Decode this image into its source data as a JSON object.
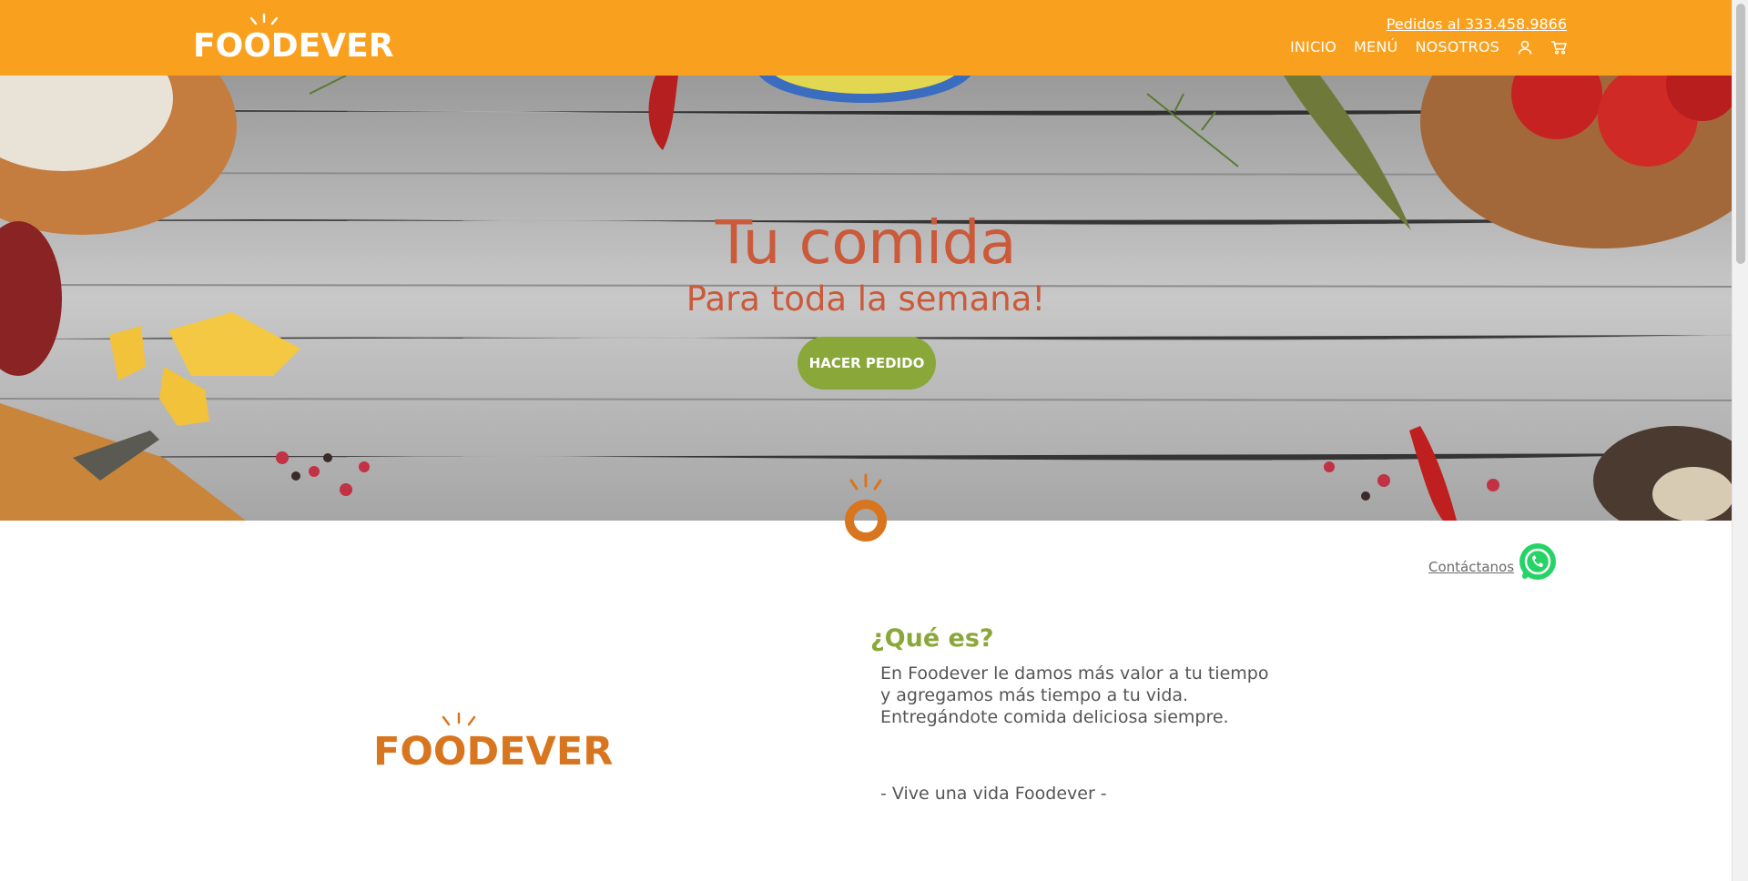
{
  "header": {
    "brand": "FOODEVER",
    "phone_link": "Pedidos al 333.458.9866",
    "nav": [
      {
        "label": "INICIO"
      },
      {
        "label": "MENÚ"
      },
      {
        "label": "NOSOTROS"
      }
    ],
    "icons": [
      "user-icon",
      "cart-icon"
    ],
    "bg_color": "#f9a11f"
  },
  "hero": {
    "title": "Tu comida",
    "subtitle": "Para toda la semana!",
    "button_label": "HACER PEDIDO",
    "title_color": "#cb5a3a",
    "button_color": "#8aa73a"
  },
  "contact": {
    "link_label": "Contáctanos",
    "icon": "whatsapp-icon"
  },
  "about": {
    "brand": "FOODEVER",
    "title": "¿Qué es?",
    "text": "En Foodever le damos más valor a tu tiempo y agregamos más tiempo a tu vida. Entregándote comida deliciosa siempre.",
    "slogan": "- Vive una vida Foodever -",
    "title_color": "#8aa73a"
  }
}
